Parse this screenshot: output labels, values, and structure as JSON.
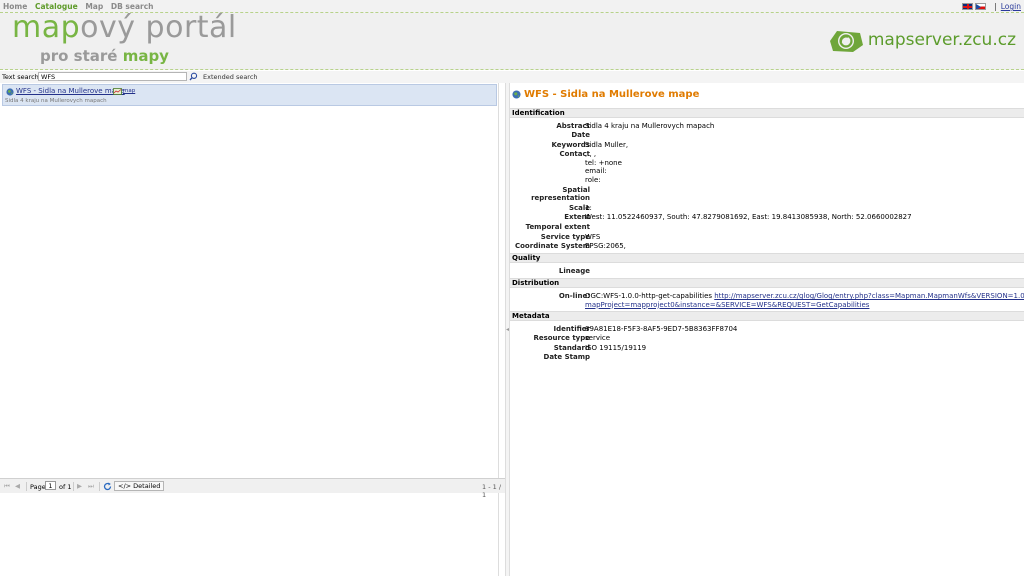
{
  "topbar": {
    "menu": [
      "Home",
      "Catalogue",
      "Map",
      "DB search"
    ],
    "active_index": 1,
    "separator": "|",
    "login": "Login"
  },
  "header": {
    "title_part1": "map",
    "title_part2": "ový portál",
    "subtitle_part1": "pro staré ",
    "subtitle_part2": "mapy",
    "brand": "mapserver.zcu.cz"
  },
  "search": {
    "label": "Text search :",
    "value": "WFS",
    "extended": "Extended search"
  },
  "results": [
    {
      "title": "WFS - Sidla na Mullerove mape",
      "map_link": "map",
      "description": "Sidla 4 kraju na Mullerovych mapach"
    }
  ],
  "pager": {
    "page_label": "Page",
    "page_value": "1",
    "of_label": "of 1",
    "detailed": "Detailed",
    "count": "1 - 1 / 1"
  },
  "detail": {
    "title": "WFS - Sidla na Mullerove mape",
    "sections": {
      "identification": "Identification",
      "quality": "Quality",
      "distribution": "Distribution",
      "metadata": "Metadata"
    },
    "fields": {
      "abstract_k": "Abstract",
      "abstract_v": "Sidla 4 kraju na Mullerovych mapach",
      "date_k": "Date",
      "keywords_k": "Keywords",
      "keywords_v": "Sidla Muller,",
      "contact_k": "Contact",
      "contact_v1": ", , ,",
      "contact_v2": "tel: +none",
      "contact_v3": "email:",
      "contact_v4": "role:",
      "spatial_k": "Spatial representation",
      "scale_k": "Scale",
      "scale_v": "1:",
      "extent_k": "Extent",
      "extent_v": "West: 11.0522460937, South: 47.8279081692, East: 19.8413085938, North: 52.0660002827",
      "temporal_k": "Temporal extent",
      "servicetype_k": "Service type",
      "servicetype_v": "WFS",
      "crs_k": "Coordinate System",
      "crs_v": "EPSG:2065,",
      "lineage_k": "Lineage",
      "online_k": "On-line:",
      "online_prefix": "OGC:WFS-1.0.0-http-get-capabilities ",
      "online_link1": "http://mapserver.zcu.cz/glog/Glog/entry.php?class=Mapman.MapmanWfs&VERSION=1.0.0&",
      "online_link2": "mapProject=mapproject0&instance=&SERVICE=WFS&REQUEST=GetCapabilities",
      "identifier_k": "Identifier",
      "identifier_v": "89A81E18-F5F3-8AF5-9ED7-5B8363FF8704",
      "resourcetype_k": "Resource type",
      "resourcetype_v": "service",
      "standard_k": "Standard",
      "standard_v": "ISO 19115/19119",
      "datestamp_k": "Date Stamp"
    }
  },
  "colors": {
    "brand_green": "#78b544",
    "title_orange": "#e07b00",
    "link_blue": "#23318a"
  }
}
